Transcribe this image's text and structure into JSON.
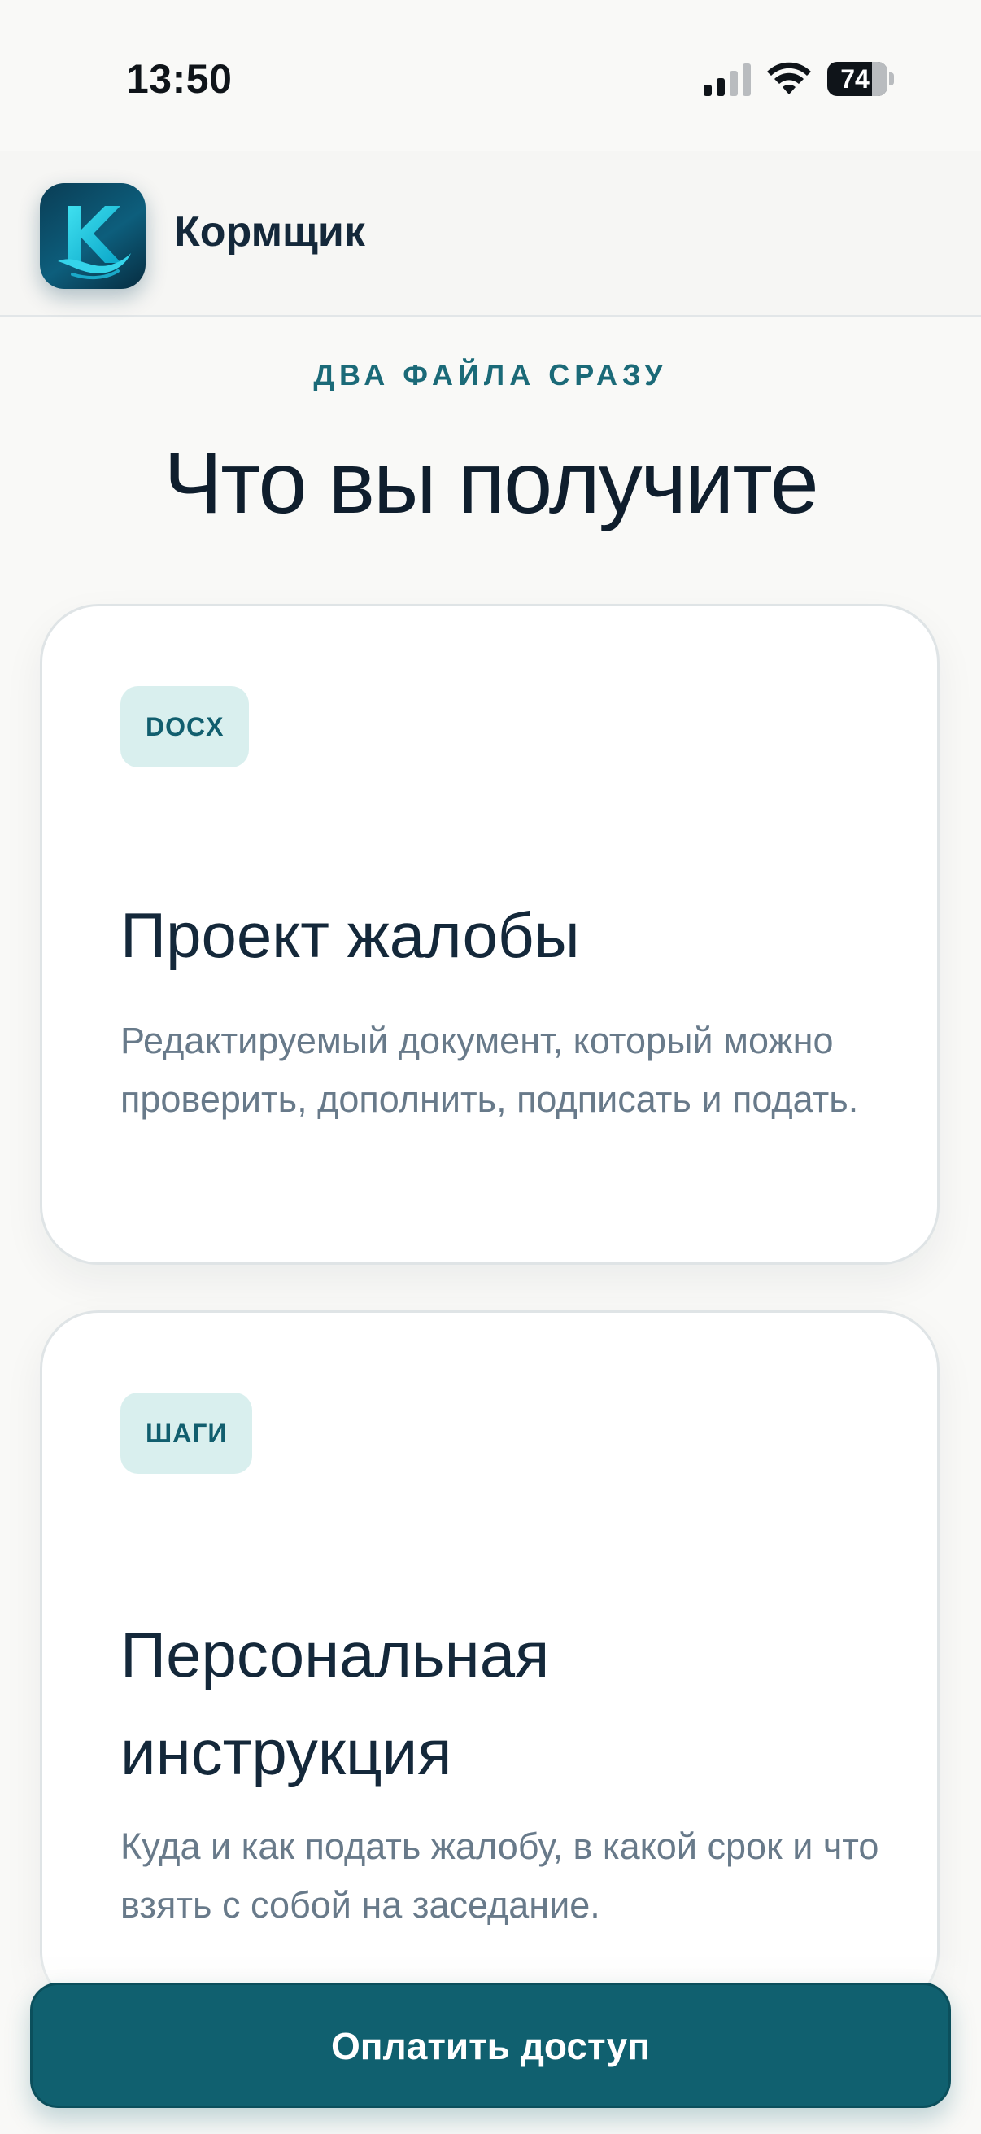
{
  "status_bar": {
    "time": "13:50",
    "battery_level": "74",
    "icons": [
      "cellular-signal-icon",
      "wifi-icon",
      "battery-icon"
    ]
  },
  "header": {
    "brand_name": "Кормщик",
    "logo_icon": "k-wave-logo"
  },
  "section": {
    "eyebrow": "ДВА ФАЙЛА СРАЗУ",
    "title": "Что вы получите"
  },
  "cards": [
    {
      "badge": "DOCX",
      "title": "Проект жалобы",
      "description": "Редактируемый документ, который можно проверить, дополнить, подписать и подать."
    },
    {
      "badge": "ШАГИ",
      "title": "Персональная инструкция",
      "description": "Куда и как подать жалобу, в какой срок и что взять с собой на заседание."
    }
  ],
  "cta": {
    "label": "Оплатить доступ"
  },
  "colors": {
    "accent": "#10606f",
    "badge_bg": "#d9efee",
    "eyebrow": "#1b6a78",
    "text_primary": "#14283a",
    "text_secondary": "#687a8a"
  }
}
